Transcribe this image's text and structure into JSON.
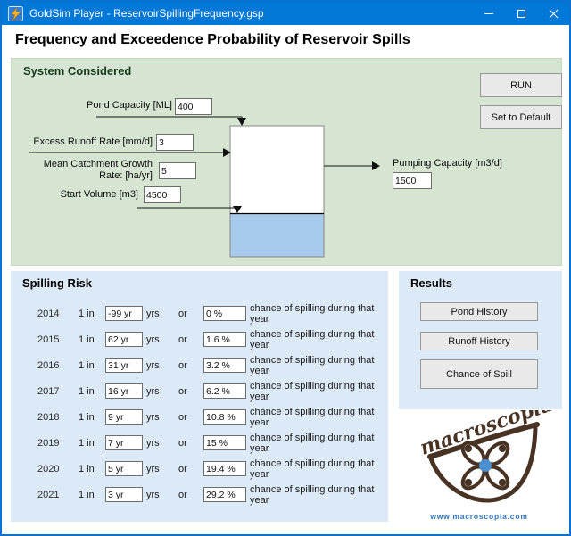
{
  "window": {
    "title": "GoldSim Player - ReservoirSpillingFrequency.gsp"
  },
  "page": {
    "heading": "Frequency and Exceedence Probability of Reservoir Spills"
  },
  "system": {
    "header": "System Considered",
    "run_button": "RUN",
    "default_button": "Set to Default",
    "pond_capacity": {
      "label": "Pond Capacity [ML]",
      "value": "400"
    },
    "excess_runoff": {
      "label": "Excess Runoff Rate [mm/d]",
      "value": "3"
    },
    "catchment_growth": {
      "label_line1": "Mean Catchment Growth",
      "label_line2": "Rate: [ha/yr]",
      "value": "5"
    },
    "start_volume": {
      "label": "Start Volume [m3]",
      "value": "4500"
    },
    "pumping_capacity": {
      "label": "Pumping Capacity [m3/d]",
      "value": "1500"
    }
  },
  "spilling_risk": {
    "header": "Spilling Risk",
    "prefix": "1 in",
    "unit": "yrs",
    "conjunction": "or",
    "suffix": "chance of spilling during that year",
    "rows": [
      {
        "year": "2014",
        "return_period": "-99 yr",
        "probability": "0 %"
      },
      {
        "year": "2015",
        "return_period": "62 yr",
        "probability": "1.6 %"
      },
      {
        "year": "2016",
        "return_period": "31 yr",
        "probability": "3.2 %"
      },
      {
        "year": "2017",
        "return_period": "16 yr",
        "probability": "6.2 %"
      },
      {
        "year": "2018",
        "return_period": "9 yr",
        "probability": "10.8 %"
      },
      {
        "year": "2019",
        "return_period": "7 yr",
        "probability": "15 %"
      },
      {
        "year": "2020",
        "return_period": "5 yr",
        "probability": "19.4 %"
      },
      {
        "year": "2021",
        "return_period": "3 yr",
        "probability": "29.2 %"
      }
    ]
  },
  "results": {
    "header": "Results",
    "buttons": [
      "Pond History",
      "Runoff History",
      "Chance of Spill"
    ]
  },
  "logo": {
    "brand": "macroscopia",
    "url": "www.macroscopia.com"
  },
  "colors": {
    "titlebar": "#0078d7",
    "system_panel": "#d5e5d2",
    "risk_panel": "#dce9f6",
    "water": "#a7c9ec",
    "brand_brown": "#473223",
    "link_blue": "#2e75b6"
  }
}
